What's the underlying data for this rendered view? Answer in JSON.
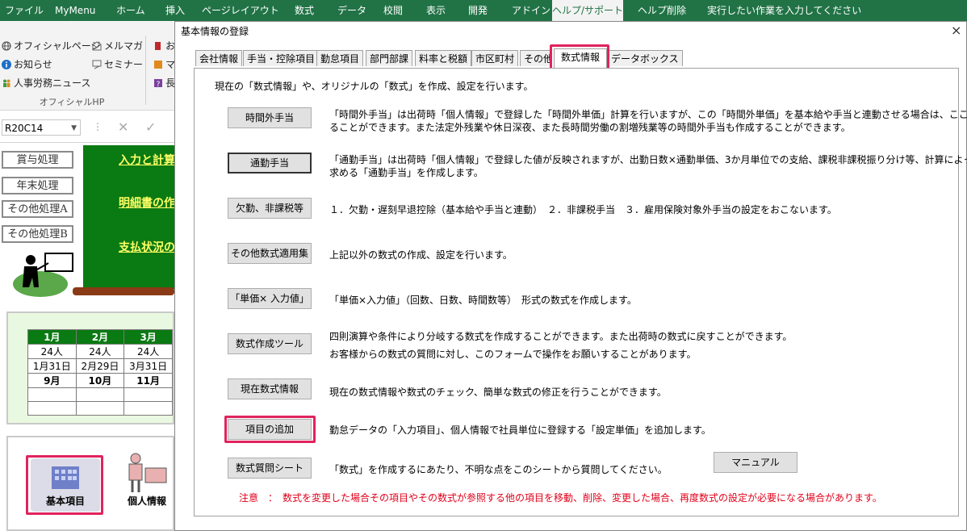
{
  "ribbon_tabs": [
    "ファイル",
    "MyMenu",
    "ホーム",
    "挿入",
    "ページレイアウト",
    "数式",
    "データ",
    "校閲",
    "表示",
    "開発",
    "アドイン",
    "ヘルプ/サポート",
    "ヘルプ削除",
    "実行したい作業を入力してください"
  ],
  "ribbon": {
    "items": [
      "オフィシャルページ",
      "メルマガ",
      "お知らせ",
      "セミナー",
      "人事労務ニュース"
    ],
    "group_label": "オフィシャルHP",
    "partial": [
      "お",
      "マ",
      "長"
    ]
  },
  "namebox": "R20C14",
  "sheet": {
    "side_buttons": [
      "賞与処理",
      "年末処理",
      "その他処理A",
      "その他処理B"
    ],
    "green_links": [
      "入力と計算",
      "明細書の作",
      "支払状況の"
    ],
    "calendar": {
      "headers": [
        "1月",
        "2月",
        "3月"
      ],
      "rows": [
        [
          "24人",
          "24人",
          "24人"
        ],
        [
          "1月31日",
          "2月29日",
          "3月31日"
        ],
        [
          "9月",
          "10月",
          "11月"
        ],
        [
          "",
          "",
          ""
        ],
        [
          "",
          "",
          ""
        ]
      ]
    },
    "bottom_buttons": [
      "基本項目",
      "個人情報"
    ]
  },
  "dialog": {
    "title": "基本情報の登録",
    "close": "×",
    "tabs": [
      "会社情報",
      "手当・控除項目",
      "勤怠項目",
      "部門部課",
      "料率と税額",
      "市区町村",
      "その他",
      "数式情報",
      "データボックス"
    ],
    "active_tab": "数式情報",
    "intro": "現在の「数式情報」や、オリジナルの「数式」を作成、設定を行います。",
    "rows": [
      {
        "button": "時間外手当",
        "desc": [
          "「時間外手当」は出荷時「個人情報」で登録した「時間外単価」計算を行いますが、この「時間外単価」を基本給や手当と連動させる場合は、ここで設定す",
          "ることができます。また法定外残業や休日深夜、また長時間労働の割増残業等の時間外手当も作成することができます。"
        ]
      },
      {
        "button": "通勤手当",
        "desc": [
          "「通勤手当」は出荷時「個人情報」で登録した値が反映されますが、出勤日数×通勤単価、3か月単位での支給、課税非課税振り分け等、計算によって",
          "求める「通勤手当」を作成します。"
        ]
      },
      {
        "button": "欠勤、非課税等",
        "desc": [
          "１．欠勤・遅刻早退控除（基本給や手当と連動）　２．非課税手当　３．雇用保険対象外手当の設定をおこないます。"
        ]
      },
      {
        "button": "その他数式適用集",
        "desc": [
          "上記以外の数式の作成、設定を行います。"
        ]
      },
      {
        "button": "「単価× 入力値」",
        "desc": [
          "「単価×入力値」（回数、日数、時間数等）　形式の数式を作成します。"
        ]
      },
      {
        "button": "数式作成ツール",
        "desc": [
          "四則演算や条件により分岐する数式を作成することができます。また出荷時の数式に戻すことができます。",
          "お客様からの数式の質問に対し、このフォームで操作をお願いすることがあります。"
        ]
      },
      {
        "button": "現在数式情報",
        "desc": [
          "現在の数式情報や数式のチェック、簡単な数式の修正を行うことができます。"
        ]
      },
      {
        "button": "項目の追加",
        "desc": [
          "勤怠データの「入力項目」、個人情報で社員単位に登録する「設定単価」を追加します。"
        ]
      },
      {
        "button": "数式質問シート",
        "desc": [
          "「数式」を作成するにあたり、不明な点をこのシートから質問してください。"
        ]
      }
    ],
    "manual_button": "マニュアル",
    "note": "注意　：　数式を変更した場合その項目やその数式が参照する他の項目を移動、削除、変更した場合、再度数式の設定が必要になる場合があります。"
  },
  "colors": {
    "excel_green": "#217346",
    "sheet_green": "#0a7a12",
    "highlight": "#e0245e",
    "note_red": "#e0001a"
  }
}
